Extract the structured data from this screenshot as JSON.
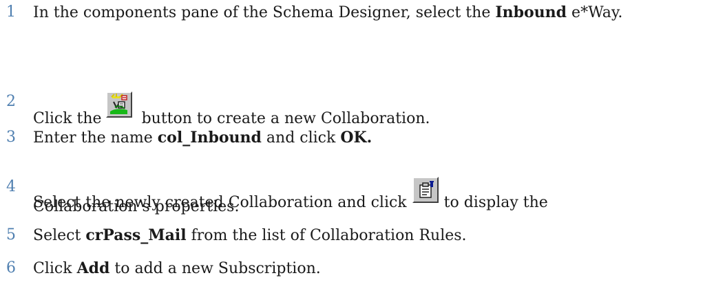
{
  "steps": [
    {
      "number": "1",
      "before": "In the components pane of the Schema Designer, select the ",
      "bold": "Inbound",
      "after": " e*Way."
    },
    {
      "number": "2",
      "before": "Click the",
      "icon": "new-collaboration-icon",
      "after": "button to create a new Collaboration."
    },
    {
      "number": "3",
      "before": "Enter the name ",
      "bold1": "col_Inbound",
      "middle": " and click ",
      "bold2": "OK."
    },
    {
      "number": "4",
      "before": "Select the newly created Collaboration and click",
      "icon": "properties-icon",
      "after": "to display the",
      "line2": "Collaboration’s properties."
    },
    {
      "number": "5",
      "before": "Select ",
      "bold": "crPass_Mail",
      "after": " from the list of Collaboration Rules."
    },
    {
      "number": "6",
      "before": "Click ",
      "bold": "Add",
      "after": " to add a new Subscription."
    }
  ]
}
